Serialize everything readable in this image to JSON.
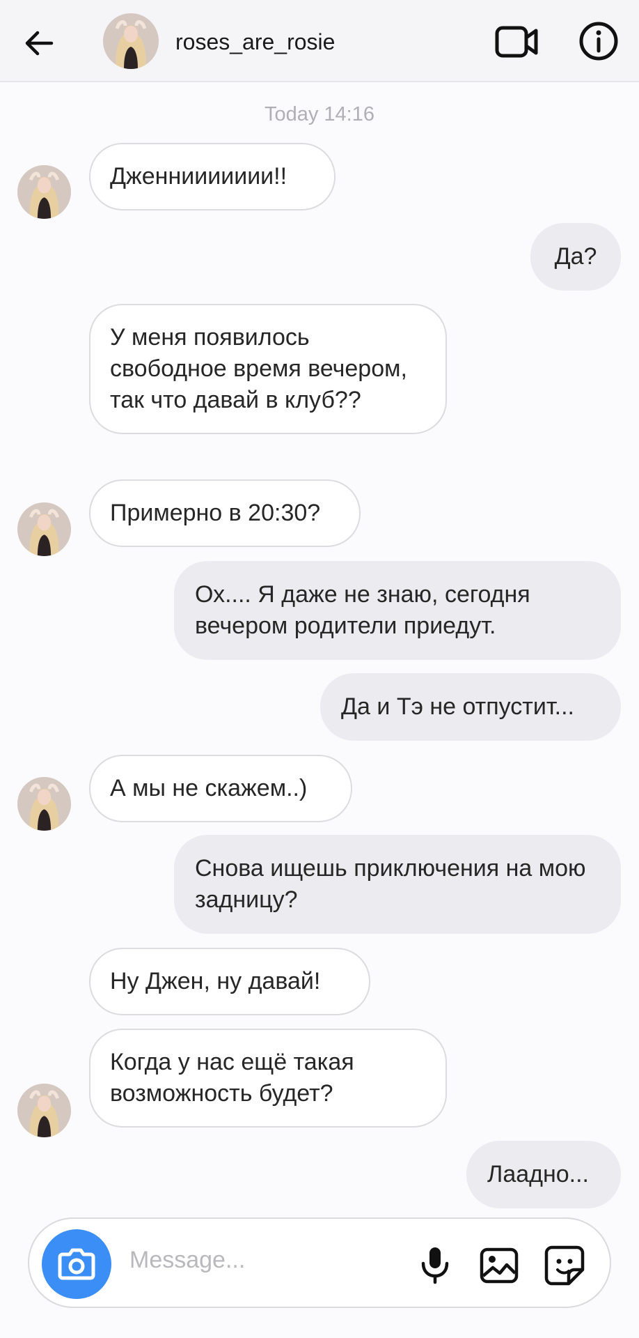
{
  "header": {
    "username": "roses_are_rosie"
  },
  "thread": {
    "timestamp": "Today 14:16",
    "messages": [
      {
        "dir": "in",
        "text": "Дженниииииии!!"
      },
      {
        "dir": "out",
        "text": "Да?"
      },
      {
        "dir": "in",
        "text": "У меня появилось свободное время вечером, так что давай в клуб??"
      },
      {
        "dir": "in",
        "text": "Примерно в 20:30?"
      },
      {
        "dir": "out",
        "text": "Ох.... Я даже не знаю, сегодня вечером родители приедут."
      },
      {
        "dir": "out",
        "text": "Да и Тэ не отпустит..."
      },
      {
        "dir": "in",
        "text": "А мы не скажем..)"
      },
      {
        "dir": "out",
        "text": "Снова ищешь приключения на мою задницу?"
      },
      {
        "dir": "in",
        "text": "Ну Джен, ну давай!"
      },
      {
        "dir": "in",
        "text": "Когда у нас ещё такая возможность будет?"
      },
      {
        "dir": "out",
        "text": "Лаадно..."
      }
    ]
  },
  "composer": {
    "placeholder": "Message..."
  },
  "icons": {
    "back": "arrow-left-icon",
    "video": "video-camera-icon",
    "info": "info-icon",
    "camera": "camera-icon",
    "mic": "microphone-icon",
    "gallery": "image-icon",
    "sticker": "sticker-icon"
  },
  "colors": {
    "accent": "#3a8ef5",
    "incoming_bubble": "#ffffff",
    "outgoing_bubble": "#ececf0"
  }
}
